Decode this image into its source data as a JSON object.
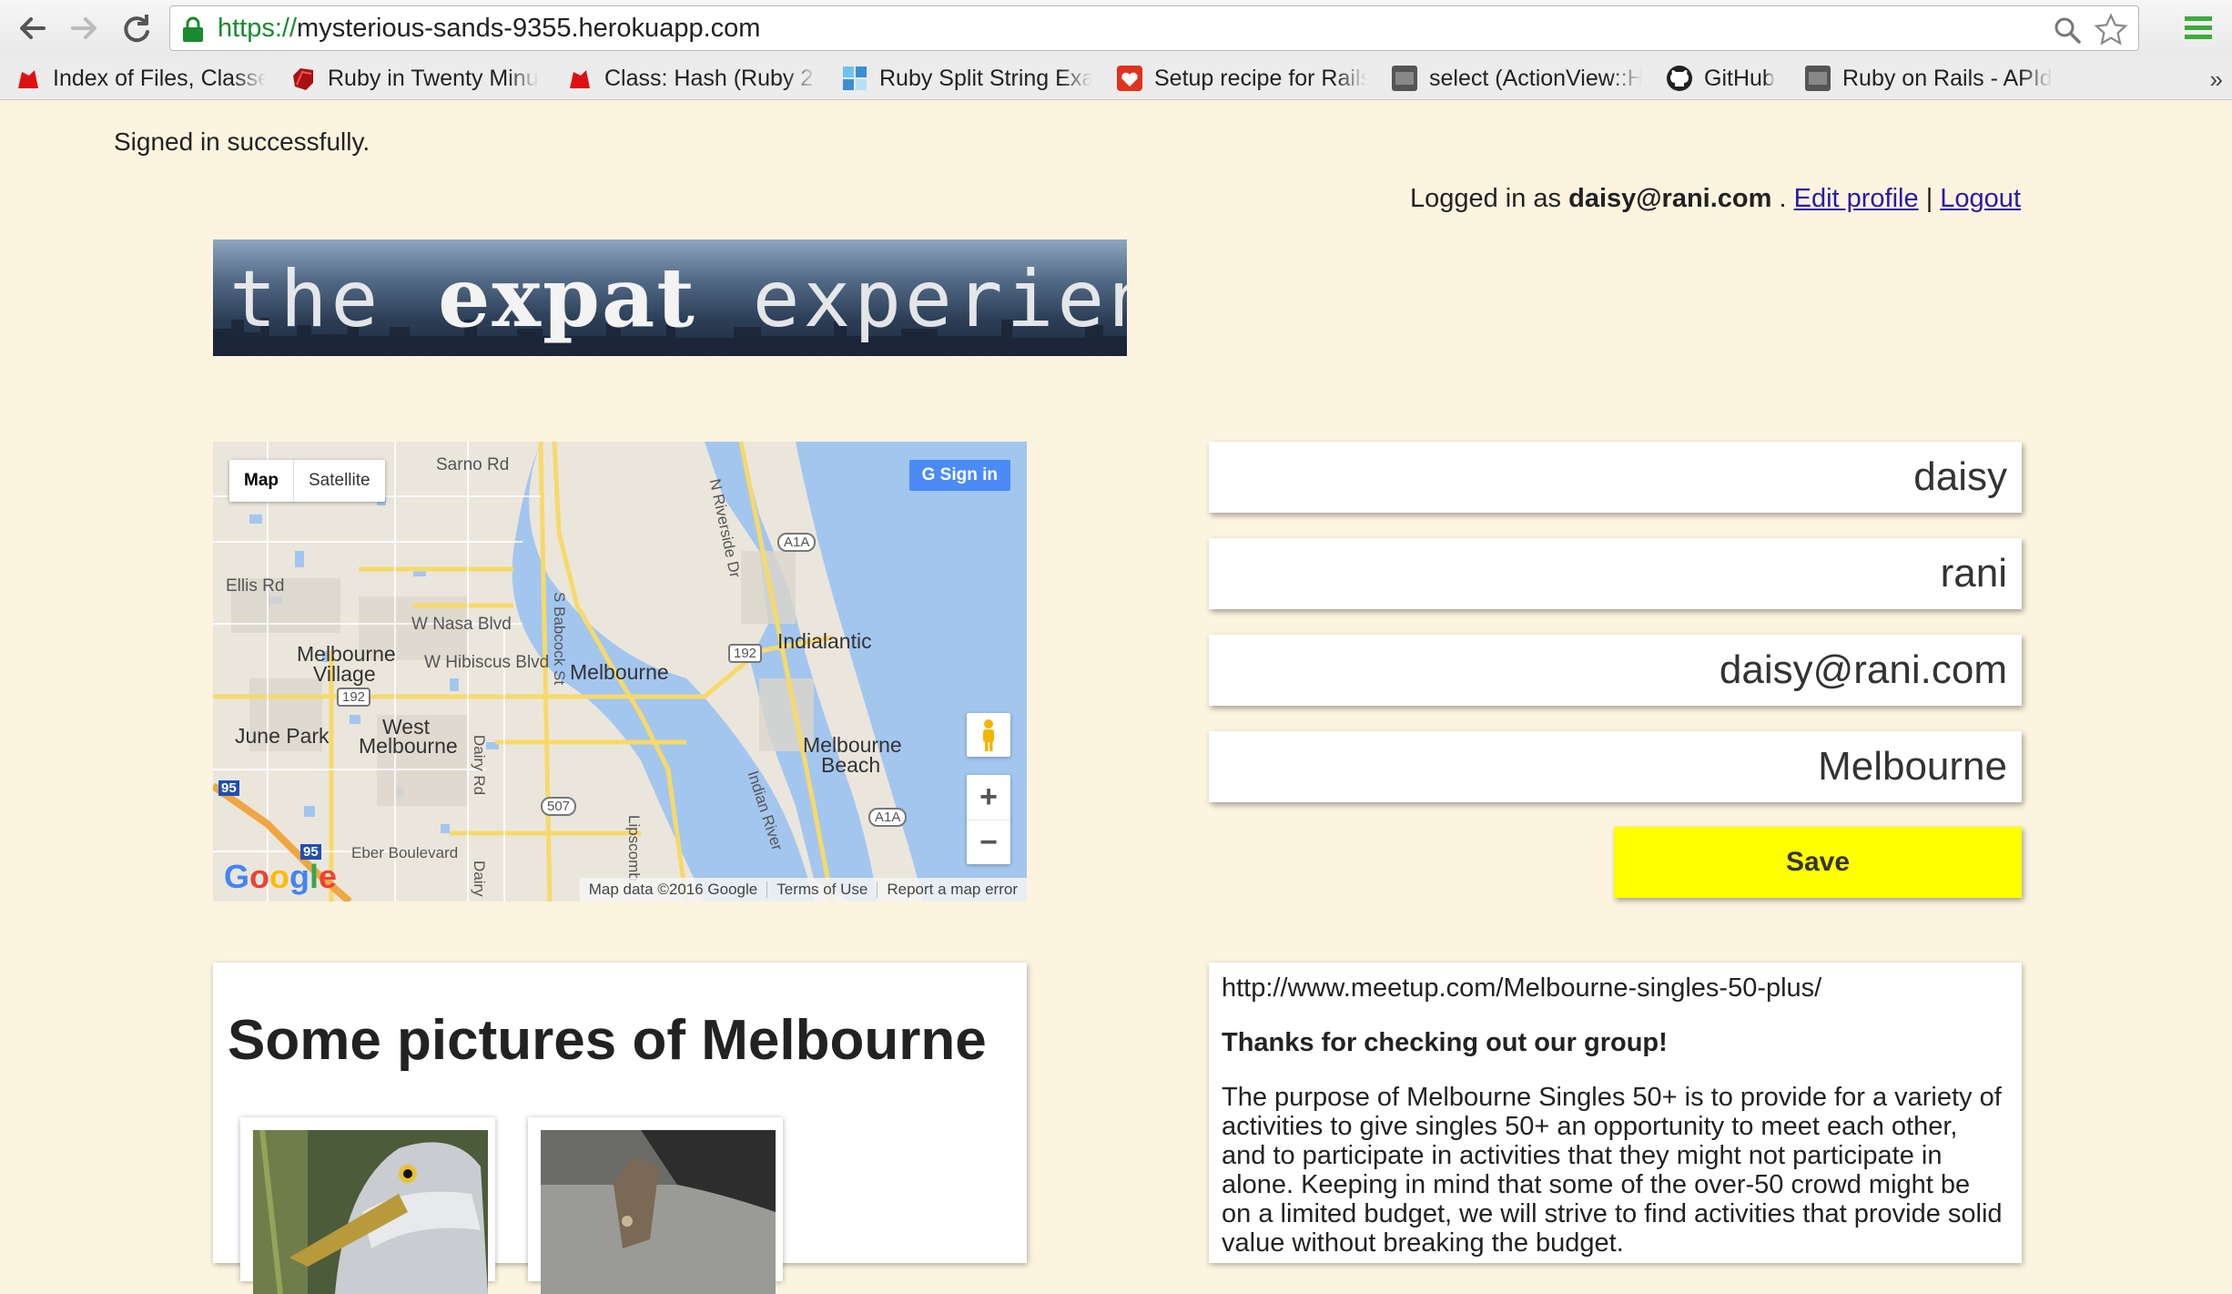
{
  "browser": {
    "url_scheme": "https://",
    "url_host": "mysterious-sands-9355.herokuapp.com",
    "bookmarks": [
      {
        "label": "Index of Files, Classe",
        "icon": "red-ruby-icon"
      },
      {
        "label": "Ruby in Twenty Minu",
        "icon": "ruby-gem-icon"
      },
      {
        "label": "Class: Hash (Ruby 2.",
        "icon": "red-ruby-icon"
      },
      {
        "label": "Ruby Split String Exa",
        "icon": "blue-squares-icon"
      },
      {
        "label": "Setup recipe for Rails",
        "icon": "heart-shield-icon"
      },
      {
        "label": "select (ActionView::H",
        "icon": "apidock-icon"
      },
      {
        "label": "GitHub",
        "icon": "github-icon"
      },
      {
        "label": "Ruby on Rails - APId",
        "icon": "apidock-icon"
      }
    ],
    "more": "»"
  },
  "flash": "Signed in successfully.",
  "userbar": {
    "prefix": "Logged in as",
    "email": "daisy@rani.com",
    "dot": ".",
    "edit_label": "Edit profile",
    "sep": "|",
    "logout_label": "Logout"
  },
  "banner": {
    "the": "the",
    "expat": "expat",
    "experience": "experience"
  },
  "map": {
    "map_label": "Map",
    "satellite_label": "Satellite",
    "signin_label": "Sign in",
    "zoom_in": "+",
    "zoom_out": "−",
    "google": "Google",
    "footer_data": "Map data ©2016 Google",
    "footer_terms": "Terms of Use",
    "footer_report": "Report a map error",
    "labels": {
      "sarno": "Sarno Rd",
      "ellis": "Ellis Rd",
      "nasa": "W Nasa Blvd",
      "hibiscus": "W Hibiscus Blvd",
      "melbourne_village_1": "Melbourne",
      "melbourne_village_2": "Village",
      "melbourne": "Melbourne",
      "indialantic": "Indialantic",
      "west_melbourne_1": "West",
      "west_melbourne_2": "Melbourne",
      "june_park": "June Park",
      "melbourne_beach_1": "Melbourne",
      "melbourne_beach_2": "Beach",
      "eber": "Eber Boulevard",
      "babcock": "S Babcock St",
      "riverside": "N Riverside Dr",
      "dairy": "Dairy Rd",
      "dairy2": "Dairy R",
      "lipscomb": "Lipscomb",
      "indian_river": "Indian River",
      "a1a": "A1A",
      "a1a_2": "A1A",
      "r192": "192",
      "r192_2": "192",
      "r507": "507",
      "i95": "95",
      "i95_2": "95"
    }
  },
  "form": {
    "first_name": "daisy",
    "last_name": "rani",
    "email": "daisy@rani.com",
    "city": "Melbourne",
    "save_label": "Save"
  },
  "pictures": {
    "title": "Some pictures of Melbourne"
  },
  "meetup": {
    "url": "http://www.meetup.com/Melbourne-singles-50-plus/",
    "heading": "Thanks for checking out our group!",
    "body": "The purpose of Melbourne Singles 50+ is to provide for a variety of activities to give singles 50+ an opportunity to meet each other, and to participate in activities that they might not participate in alone. Keeping in mind that some of the over-50 crowd might be on a limited budget, we will strive to find activities that provide solid value without breaking the budget."
  },
  "colors": {
    "page_bg": "#fcf4df",
    "link": "#2a1aa6",
    "save_button": "#ffff00",
    "water": "#a3c6ef"
  }
}
